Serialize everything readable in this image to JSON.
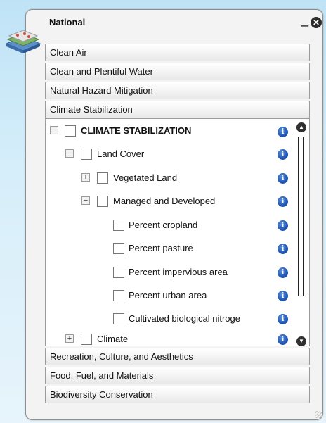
{
  "window": {
    "title": "National",
    "minimize_glyph": "_",
    "close_glyph": "✕"
  },
  "sections_top": [
    {
      "label": "Clean Air"
    },
    {
      "label": "Clean and Plentiful Water"
    },
    {
      "label": "Natural Hazard Mitigation"
    },
    {
      "label": "Climate Stabilization"
    }
  ],
  "tree": {
    "rows": [
      {
        "label": "CLIMATE STABILIZATION",
        "toggle": "−"
      },
      {
        "label": "Land Cover",
        "toggle": "−"
      },
      {
        "label": "Vegetated Land",
        "toggle": "+"
      },
      {
        "label": "Managed and Developed",
        "toggle": "−"
      },
      {
        "label": "Percent cropland"
      },
      {
        "label": "Percent pasture"
      },
      {
        "label": "Percent impervious area"
      },
      {
        "label": "Percent urban area"
      },
      {
        "label": "Cultivated biological nitroge"
      },
      {
        "label": "Climate",
        "toggle": "+"
      }
    ],
    "info_glyph": "i",
    "scroll_up_glyph": "▲",
    "scroll_down_glyph": "▼"
  },
  "sections_bottom": [
    {
      "label": "Recreation, Culture, and Aesthetics"
    },
    {
      "label": "Food, Fuel, and Materials"
    },
    {
      "label": "Biodiversity Conservation"
    }
  ],
  "colors": {
    "info_icon": "#1f56b7",
    "panel_bg": "#f3f3f3",
    "sky_bg": "#bfe3f6"
  }
}
